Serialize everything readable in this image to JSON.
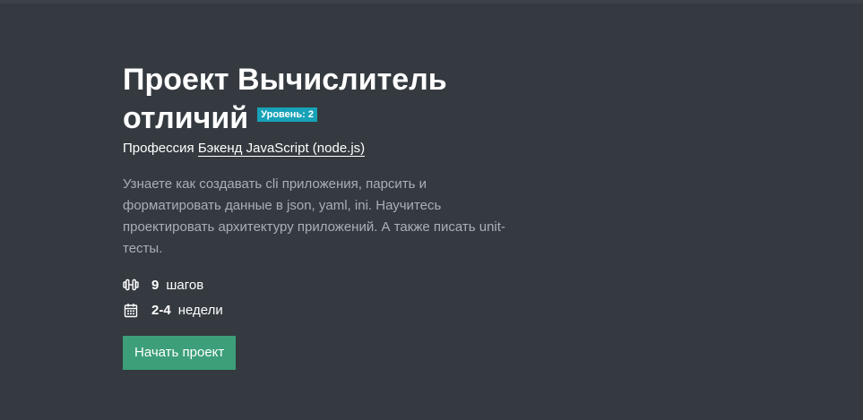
{
  "project": {
    "title": "Проект Вычислитель отличий",
    "level_badge": "Уровень: 2",
    "profession_prefix": "Профессия",
    "profession_link": "Бэкенд JavaScript (node.js)",
    "description": "Узнаете как создавать cli приложения, парсить и форматировать данные в json, yaml, ini. Научитесь проектировать архитектуру приложений. А также писать unit-тесты."
  },
  "stats": {
    "steps": {
      "icon": "dumbbell-icon",
      "value": "9",
      "label": "шагов"
    },
    "duration": {
      "icon": "calendar-icon",
      "value": "2-4",
      "label": "недели"
    }
  },
  "actions": {
    "start_label": "Начать проект"
  },
  "colors": {
    "background": "#343a40",
    "badge": "#17a2b8",
    "button": "#3c9f7a",
    "muted_text": "#a9afb5"
  }
}
